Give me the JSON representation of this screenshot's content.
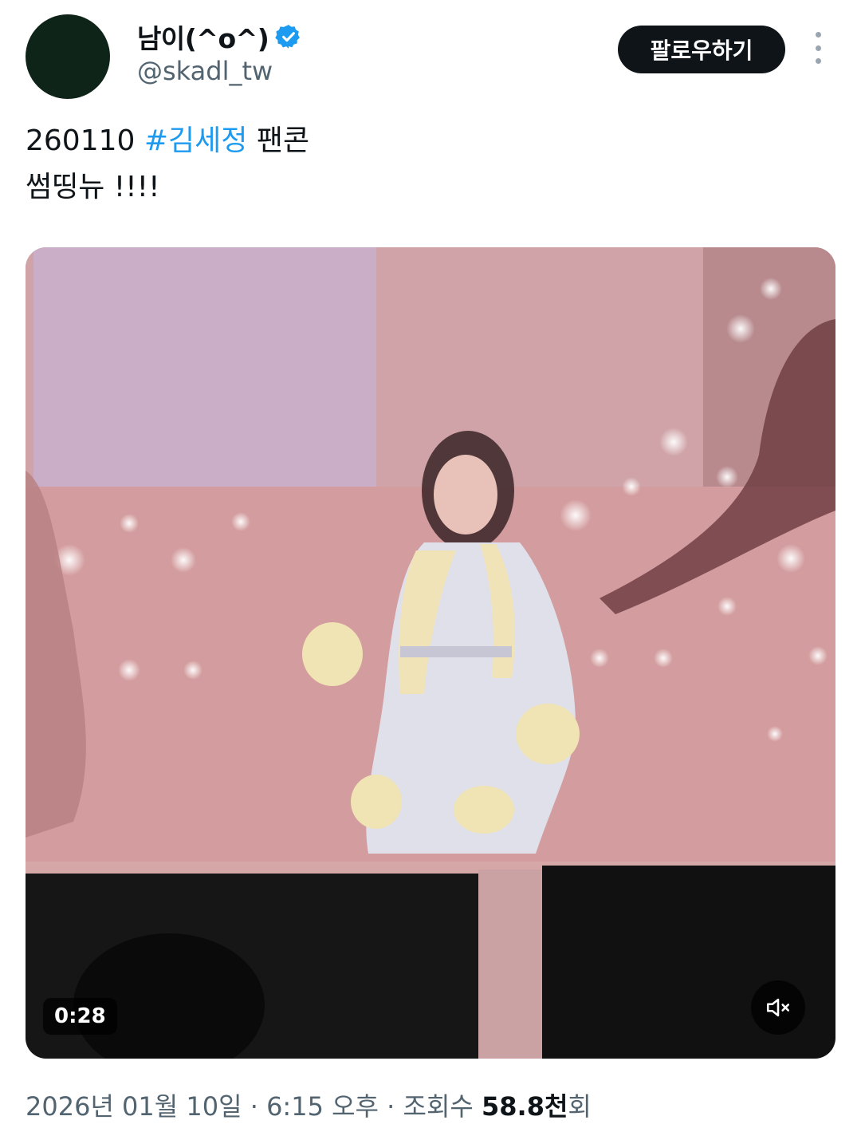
{
  "tweet": {
    "display_name": "남이(^o^)",
    "handle": "@skadl_tw",
    "follow_label": "팔로우하기",
    "text_prefix": "260110 ",
    "hashtag": "#김세정",
    "text_suffix": " 팬콘",
    "text_line2": "썸띵뉴 !!!!",
    "media": {
      "type": "video",
      "duration": "0:28",
      "muted": true
    },
    "meta": {
      "date": "2026년 01월 10일",
      "separator": " · ",
      "time": "6:15 오후",
      "views_label": "조회수 ",
      "views_count": "58.8천",
      "views_suffix": "회"
    }
  },
  "colors": {
    "accent": "#1d9bf0",
    "text": "#0f1419",
    "muted": "#536471",
    "button": "#0f1419"
  },
  "icons": {
    "verified": "verified-badge-icon",
    "more": "more-vertical-icon",
    "mute": "volume-muted-icon"
  }
}
